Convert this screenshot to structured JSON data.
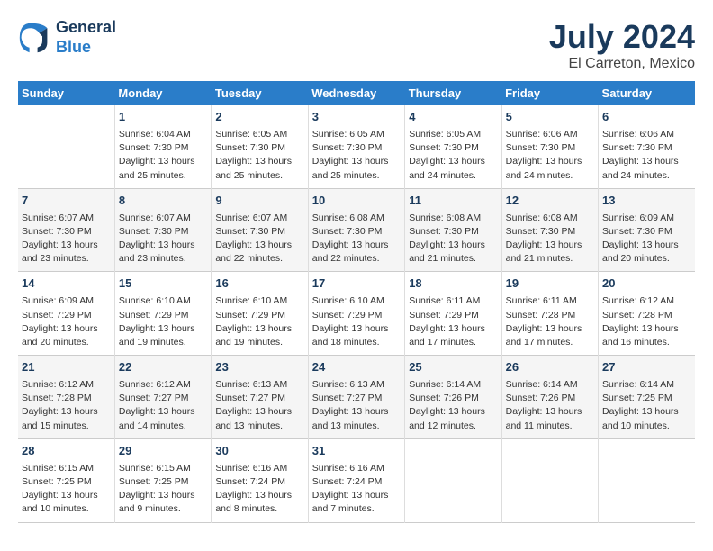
{
  "header": {
    "logo_line1": "General",
    "logo_line2": "Blue",
    "main_title": "July 2024",
    "subtitle": "El Carreton, Mexico"
  },
  "days_of_week": [
    "Sunday",
    "Monday",
    "Tuesday",
    "Wednesday",
    "Thursday",
    "Friday",
    "Saturday"
  ],
  "weeks": [
    [
      {
        "day": "",
        "info": ""
      },
      {
        "day": "1",
        "info": "Sunrise: 6:04 AM\nSunset: 7:30 PM\nDaylight: 13 hours\nand 25 minutes."
      },
      {
        "day": "2",
        "info": "Sunrise: 6:05 AM\nSunset: 7:30 PM\nDaylight: 13 hours\nand 25 minutes."
      },
      {
        "day": "3",
        "info": "Sunrise: 6:05 AM\nSunset: 7:30 PM\nDaylight: 13 hours\nand 25 minutes."
      },
      {
        "day": "4",
        "info": "Sunrise: 6:05 AM\nSunset: 7:30 PM\nDaylight: 13 hours\nand 24 minutes."
      },
      {
        "day": "5",
        "info": "Sunrise: 6:06 AM\nSunset: 7:30 PM\nDaylight: 13 hours\nand 24 minutes."
      },
      {
        "day": "6",
        "info": "Sunrise: 6:06 AM\nSunset: 7:30 PM\nDaylight: 13 hours\nand 24 minutes."
      }
    ],
    [
      {
        "day": "7",
        "info": "Sunrise: 6:07 AM\nSunset: 7:30 PM\nDaylight: 13 hours\nand 23 minutes."
      },
      {
        "day": "8",
        "info": "Sunrise: 6:07 AM\nSunset: 7:30 PM\nDaylight: 13 hours\nand 23 minutes."
      },
      {
        "day": "9",
        "info": "Sunrise: 6:07 AM\nSunset: 7:30 PM\nDaylight: 13 hours\nand 22 minutes."
      },
      {
        "day": "10",
        "info": "Sunrise: 6:08 AM\nSunset: 7:30 PM\nDaylight: 13 hours\nand 22 minutes."
      },
      {
        "day": "11",
        "info": "Sunrise: 6:08 AM\nSunset: 7:30 PM\nDaylight: 13 hours\nand 21 minutes."
      },
      {
        "day": "12",
        "info": "Sunrise: 6:08 AM\nSunset: 7:30 PM\nDaylight: 13 hours\nand 21 minutes."
      },
      {
        "day": "13",
        "info": "Sunrise: 6:09 AM\nSunset: 7:30 PM\nDaylight: 13 hours\nand 20 minutes."
      }
    ],
    [
      {
        "day": "14",
        "info": "Sunrise: 6:09 AM\nSunset: 7:29 PM\nDaylight: 13 hours\nand 20 minutes."
      },
      {
        "day": "15",
        "info": "Sunrise: 6:10 AM\nSunset: 7:29 PM\nDaylight: 13 hours\nand 19 minutes."
      },
      {
        "day": "16",
        "info": "Sunrise: 6:10 AM\nSunset: 7:29 PM\nDaylight: 13 hours\nand 19 minutes."
      },
      {
        "day": "17",
        "info": "Sunrise: 6:10 AM\nSunset: 7:29 PM\nDaylight: 13 hours\nand 18 minutes."
      },
      {
        "day": "18",
        "info": "Sunrise: 6:11 AM\nSunset: 7:29 PM\nDaylight: 13 hours\nand 17 minutes."
      },
      {
        "day": "19",
        "info": "Sunrise: 6:11 AM\nSunset: 7:28 PM\nDaylight: 13 hours\nand 17 minutes."
      },
      {
        "day": "20",
        "info": "Sunrise: 6:12 AM\nSunset: 7:28 PM\nDaylight: 13 hours\nand 16 minutes."
      }
    ],
    [
      {
        "day": "21",
        "info": "Sunrise: 6:12 AM\nSunset: 7:28 PM\nDaylight: 13 hours\nand 15 minutes."
      },
      {
        "day": "22",
        "info": "Sunrise: 6:12 AM\nSunset: 7:27 PM\nDaylight: 13 hours\nand 14 minutes."
      },
      {
        "day": "23",
        "info": "Sunrise: 6:13 AM\nSunset: 7:27 PM\nDaylight: 13 hours\nand 13 minutes."
      },
      {
        "day": "24",
        "info": "Sunrise: 6:13 AM\nSunset: 7:27 PM\nDaylight: 13 hours\nand 13 minutes."
      },
      {
        "day": "25",
        "info": "Sunrise: 6:14 AM\nSunset: 7:26 PM\nDaylight: 13 hours\nand 12 minutes."
      },
      {
        "day": "26",
        "info": "Sunrise: 6:14 AM\nSunset: 7:26 PM\nDaylight: 13 hours\nand 11 minutes."
      },
      {
        "day": "27",
        "info": "Sunrise: 6:14 AM\nSunset: 7:25 PM\nDaylight: 13 hours\nand 10 minutes."
      }
    ],
    [
      {
        "day": "28",
        "info": "Sunrise: 6:15 AM\nSunset: 7:25 PM\nDaylight: 13 hours\nand 10 minutes."
      },
      {
        "day": "29",
        "info": "Sunrise: 6:15 AM\nSunset: 7:25 PM\nDaylight: 13 hours\nand 9 minutes."
      },
      {
        "day": "30",
        "info": "Sunrise: 6:16 AM\nSunset: 7:24 PM\nDaylight: 13 hours\nand 8 minutes."
      },
      {
        "day": "31",
        "info": "Sunrise: 6:16 AM\nSunset: 7:24 PM\nDaylight: 13 hours\nand 7 minutes."
      },
      {
        "day": "",
        "info": ""
      },
      {
        "day": "",
        "info": ""
      },
      {
        "day": "",
        "info": ""
      }
    ]
  ]
}
